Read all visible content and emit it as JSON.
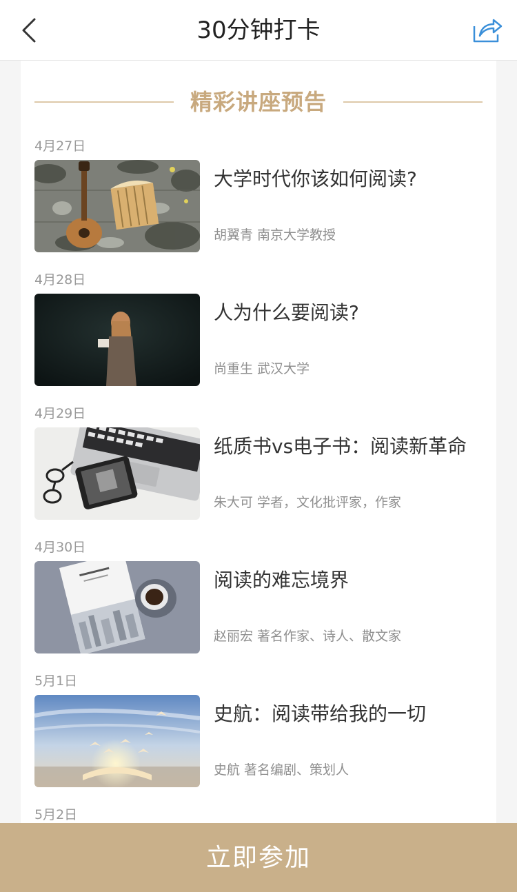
{
  "nav": {
    "title": "30分钟打卡"
  },
  "section": {
    "title": "精彩讲座预告"
  },
  "lectures": [
    {
      "date": "4月27日",
      "title": "大学时代你该如何阅读?",
      "speaker": "胡翼青 南京大学教授"
    },
    {
      "date": "4月28日",
      "title": "人为什么要阅读?",
      "speaker": "尚重生 武汉大学"
    },
    {
      "date": "4月29日",
      "title": "纸质书vs电子书：阅读新革命",
      "speaker": "朱大可 学者，文化批评家，作家"
    },
    {
      "date": "4月30日",
      "title": "阅读的难忘境界",
      "speaker": "赵丽宏 著名作家、诗人、散文家"
    },
    {
      "date": "5月1日",
      "title": "史航：阅读带给我的一切",
      "speaker": "史航 著名编剧、策划人"
    },
    {
      "date": "5月2日",
      "title": "",
      "speaker": ""
    }
  ],
  "footer": {
    "join_label": "立即参加"
  },
  "colors": {
    "accent_gold": "#c8a97e",
    "button_bg": "#c9b08a",
    "share_blue": "#3a8fd9"
  }
}
